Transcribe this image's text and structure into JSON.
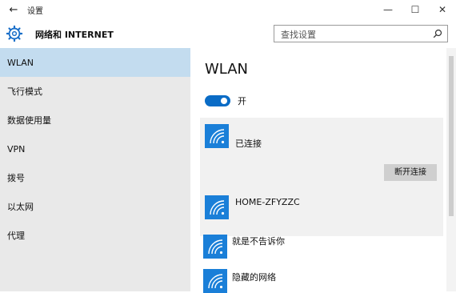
{
  "window": {
    "title": "设置",
    "back_icon": "back-arrow-icon",
    "controls": [
      "minimize-icon",
      "maximize-icon",
      "close-icon"
    ]
  },
  "header": {
    "title": "网络和 INTERNET",
    "icon": "gear-icon",
    "search": {
      "placeholder": "查找设置",
      "icon": "search-icon"
    }
  },
  "sidebar": {
    "items": [
      {
        "label": "WLAN",
        "active": true
      },
      {
        "label": "飞行模式"
      },
      {
        "label": "数据使用量"
      },
      {
        "label": "VPN"
      },
      {
        "label": "拨号"
      },
      {
        "label": "以太网"
      },
      {
        "label": "代理"
      }
    ]
  },
  "main": {
    "title": "WLAN",
    "toggle": {
      "state": "on",
      "label": "开"
    },
    "networks": [
      {
        "name": "",
        "status": "已连接",
        "selected": true,
        "button": "断开连接",
        "icon": "wifi-icon"
      },
      {
        "name": "HOME-ZFYZZC",
        "icon": "wifi-icon"
      },
      {
        "name": "就是不告诉你",
        "icon": "wifi-icon"
      },
      {
        "name": "隐藏的网络",
        "icon": "wifi-icon"
      }
    ]
  },
  "colors": {
    "accent": "#0a6cc6",
    "wifi_tile": "#1a7fd8",
    "sidebar_bg": "#e9e9e9",
    "sidebar_active": "#c3dcef"
  }
}
